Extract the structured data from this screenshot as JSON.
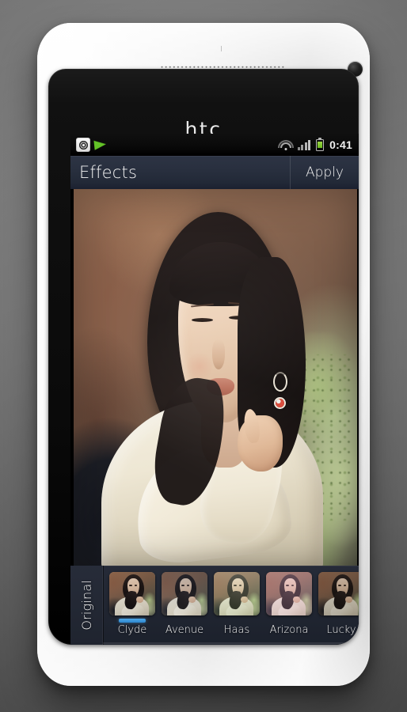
{
  "device": {
    "brand_logo": "htc",
    "speaker_icon": "speaker-grille-icon",
    "front_camera_icon": "front-camera-icon"
  },
  "status_bar": {
    "left_icons": [
      {
        "name": "camera-app-icon",
        "label": "camera"
      },
      {
        "name": "send-arrow-icon",
        "label": "share"
      }
    ],
    "right_icons": [
      {
        "name": "wifi-icon",
        "label": "wifi"
      },
      {
        "name": "signal-icon",
        "label": "signal"
      },
      {
        "name": "battery-icon",
        "label": "battery"
      }
    ],
    "clock": "0:41"
  },
  "title_bar": {
    "title": "Effects",
    "apply_label": "Apply"
  },
  "photo": {
    "alt": "portrait of a woman with dark hair in a cream sweater"
  },
  "filmstrip": {
    "original_label": "Original",
    "selected_index": 0,
    "thumbnails": [
      {
        "label": "Clyde",
        "tint_class": "tint-clyde",
        "selected": true
      },
      {
        "label": "Avenue",
        "tint_class": "tint-avenue",
        "selected": false
      },
      {
        "label": "Haas",
        "tint_class": "tint-haas",
        "selected": false
      },
      {
        "label": "Arizona",
        "tint_class": "tint-arizona",
        "selected": false
      },
      {
        "label": "Lucky",
        "tint_class": "tint-lucky",
        "selected": false
      }
    ]
  },
  "nav_bar": {
    "buttons": [
      {
        "name": "back-button",
        "icon": "back-chevron-icon",
        "pressed": true
      },
      {
        "name": "home-button",
        "icon": "home-icon",
        "pressed": false
      },
      {
        "name": "recents-button",
        "icon": "recents-icon",
        "pressed": false
      }
    ]
  },
  "colors": {
    "accent_blue": "#2c86cf",
    "title_bar": "#282f3e",
    "filmstrip": "#222733",
    "battery_green": "#6cb81f"
  }
}
